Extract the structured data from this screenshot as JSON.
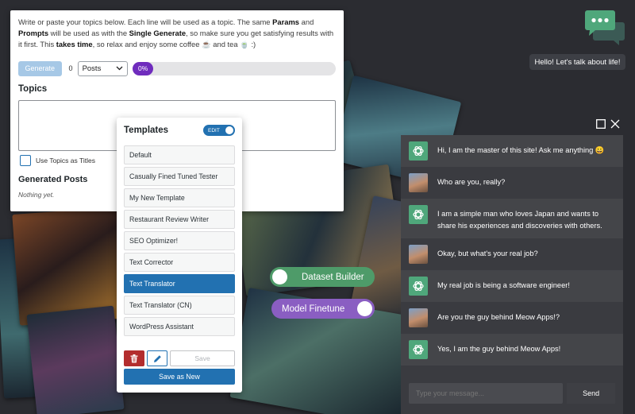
{
  "intro": {
    "p1": "Write or paste your topics below. Each line will be used as a topic. The same ",
    "b1": "Params",
    "p2": " and ",
    "b2": "Prompts",
    "p3": " will be used as with the ",
    "b3": "Single Generate",
    "p4": ", so make sure you get satisfying results with it first. This ",
    "b4": "takes time",
    "p5": ", so relax and enjoy some coffee ☕ and tea 🍵 :)"
  },
  "generate": {
    "button_label": "Generate",
    "count": "0",
    "post_type": "Posts",
    "progress_label": "0%",
    "progress_value": 0
  },
  "topics": {
    "title": "Topics",
    "value": "",
    "use_as_titles_label": "Use Topics as Titles"
  },
  "generated_posts": {
    "title": "Generated Posts",
    "empty_text": "Nothing yet."
  },
  "templates": {
    "title": "Templates",
    "edit_label": "EDIT",
    "items": [
      {
        "label": "Default"
      },
      {
        "label": "Casually Fined Tuned Tester"
      },
      {
        "label": "My New Template"
      },
      {
        "label": "Restaurant Review Writer"
      },
      {
        "label": "SEO Optimizer!"
      },
      {
        "label": "Text Corrector"
      },
      {
        "label": "Text Translator"
      },
      {
        "label": "Text Translator (CN)"
      },
      {
        "label": "WordPress Assistant"
      }
    ],
    "active_item": "Text Translator",
    "save_label": "Save",
    "save_new_label": "Save as New"
  },
  "pills": {
    "dataset_builder": "Dataset Builder",
    "model_finetune": "Model Finetune"
  },
  "chatbot": {
    "greeting": "Hello! Let's talk about life!",
    "input_placeholder": "Type your message...",
    "send_label": "Send",
    "messages": [
      {
        "role": "ai",
        "text": "Hi, I am the master of this site! Ask me anything 😀"
      },
      {
        "role": "user",
        "text": "Who are you, really?"
      },
      {
        "role": "ai",
        "text": "I am a simple man who loves Japan and wants to share his experiences and discoveries with others."
      },
      {
        "role": "user",
        "text": "Okay, but what's your real job?"
      },
      {
        "role": "ai",
        "text": "My real job is being a software engineer!"
      },
      {
        "role": "user",
        "text": "Are you the guy behind Meow Apps!?"
      },
      {
        "role": "ai",
        "text": "Yes, I am the guy behind Meow Apps!"
      }
    ]
  },
  "colors": {
    "accent": "#2271b1",
    "progress": "#6f2cbd",
    "ai_avatar": "#4fa77b",
    "chat_icon": "#4fa77b"
  },
  "icons": {
    "chat": "chat-bubbles-icon",
    "ai_avatar": "openai-icon",
    "delete": "trash-icon",
    "edit": "pencil-icon",
    "maximize": "maximize-icon",
    "close": "close-icon"
  }
}
